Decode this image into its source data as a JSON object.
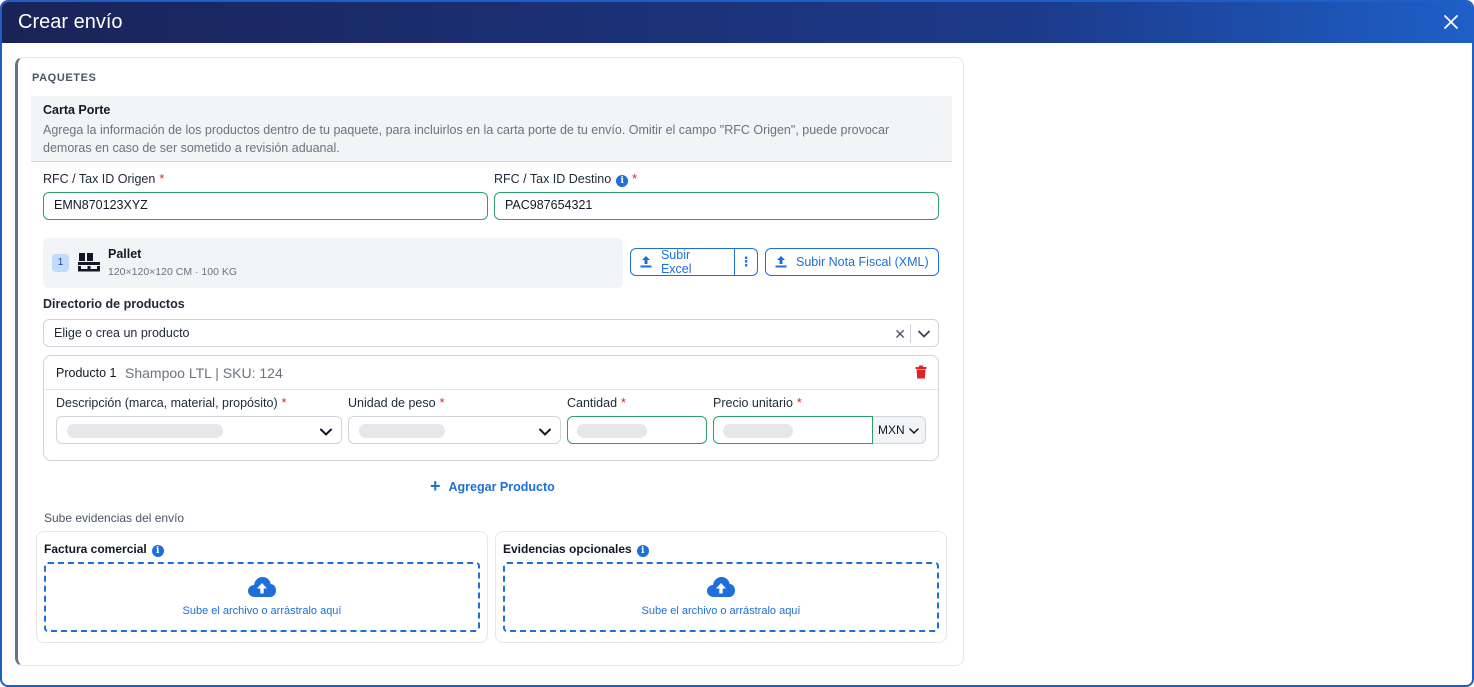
{
  "modal": {
    "title": "Crear envío"
  },
  "section": {
    "title": "PAQUETES"
  },
  "carta": {
    "title": "Carta Porte",
    "description": "Agrega la información de los productos dentro de tu paquete, para incluirlos en la carta porte de tu envío. Omitir el campo \"RFC Origen\", puede provocar demoras en caso de ser sometido a revisión aduanal."
  },
  "rfc": {
    "origen_label": "RFC / Tax ID Origen",
    "origen_value": "EMN870123XYZ",
    "destino_label": "RFC / Tax ID Destino",
    "destino_value": "PAC987654321",
    "required_mark": "*"
  },
  "pallet": {
    "index": "1",
    "name": "Pallet",
    "dims": "120×120×120 CM · 100 KG"
  },
  "buttons": {
    "subir_excel": "Subir Excel",
    "subir_nota": "Subir Nota Fiscal (XML)",
    "agregar_producto": "Agregar Producto"
  },
  "directorio": {
    "label": "Directorio de productos",
    "placeholder": "Elige o crea un producto"
  },
  "producto": {
    "number": "Producto 1",
    "name": "Shampoo LTL | SKU: 124",
    "fields": {
      "descripcion": "Descripción (marca, material, propósito)",
      "unidad": "Unidad de peso",
      "cantidad": "Cantidad",
      "precio": "Precio unitario"
    },
    "currency": "MXN"
  },
  "evidencias": {
    "title": "Sube evidencias del envío",
    "factura_label": "Factura comercial",
    "opcionales_label": "Evidencias opcionales",
    "drop_text": "Sube el archivo o arrástralo aquí"
  },
  "colors": {
    "header_start": "#1a2358",
    "header_end": "#1e5fc7",
    "accent": "#1e6fd9",
    "valid_border": "#2e9e6d",
    "required": "#dc2626"
  },
  "icons": [
    "close-icon",
    "info-icon",
    "pallet-icon",
    "upload-icon",
    "kebab-icon",
    "clear-icon",
    "chevron-down-icon",
    "trash-icon",
    "plus-icon",
    "cloud-upload-icon"
  ]
}
